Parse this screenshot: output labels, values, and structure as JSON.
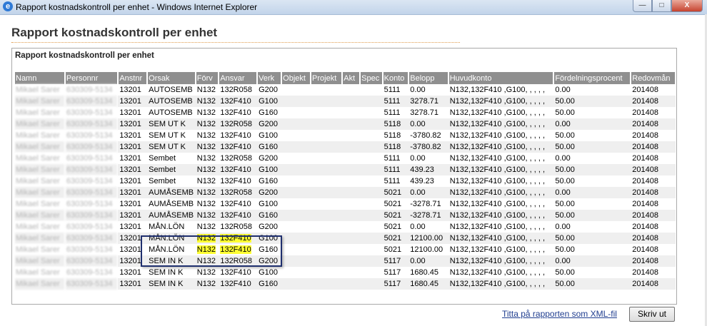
{
  "window": {
    "title": "Rapport kostnadskontroll per enhet - Windows Internet Explorer",
    "icon": "ie-icon",
    "min_label": "—",
    "max_label": "□",
    "close_label": "X"
  },
  "page": {
    "title": "Rapport kostnadskontroll per enhet"
  },
  "report": {
    "heading": "Rapport kostnadskontroll per enhet",
    "columns": [
      "Namn",
      "Personnr",
      "Anstnr",
      "Orsak",
      "Förv",
      "Ansvar",
      "Verk",
      "Objekt",
      "Projekt",
      "Akt",
      "Spec",
      "Konto",
      "Belopp",
      "Huvudkonto",
      "Fördelningsprocent",
      "Redovmån"
    ],
    "rows": [
      [
        "Mikael Sarer",
        "630309-5134",
        "13201",
        "AUTOSEMB",
        "N132",
        "132R058",
        "G200",
        "",
        "",
        "",
        "",
        "5111",
        "0.00",
        "N132,132F410 ,G100, , , , ,",
        "0.00",
        "201408"
      ],
      [
        "Mikael Sarer",
        "630309-5134",
        "13201",
        "AUTOSEMB",
        "N132",
        "132F410",
        "G100",
        "",
        "",
        "",
        "",
        "5111",
        "3278.71",
        "N132,132F410 ,G100, , , , ,",
        "50.00",
        "201408"
      ],
      [
        "Mikael Sarer",
        "630309-5134",
        "13201",
        "AUTOSEMB",
        "N132",
        "132F410",
        "G160",
        "",
        "",
        "",
        "",
        "5111",
        "3278.71",
        "N132,132F410 ,G100, , , , ,",
        "50.00",
        "201408"
      ],
      [
        "Mikael Sarer",
        "630309-5134",
        "13201",
        "SEM UT K",
        "N132",
        "132R058",
        "G200",
        "",
        "",
        "",
        "",
        "5118",
        "0.00",
        "N132,132F410 ,G100, , , , ,",
        "0.00",
        "201408"
      ],
      [
        "Mikael Sarer",
        "630309-5134",
        "13201",
        "SEM UT K",
        "N132",
        "132F410",
        "G100",
        "",
        "",
        "",
        "",
        "5118",
        "-3780.82",
        "N132,132F410 ,G100, , , , ,",
        "50.00",
        "201408"
      ],
      [
        "Mikael Sarer",
        "630309-5134",
        "13201",
        "SEM UT K",
        "N132",
        "132F410",
        "G160",
        "",
        "",
        "",
        "",
        "5118",
        "-3780.82",
        "N132,132F410 ,G100, , , , ,",
        "50.00",
        "201408"
      ],
      [
        "Mikael Sarer",
        "630309-5134",
        "13201",
        "Sembet",
        "N132",
        "132R058",
        "G200",
        "",
        "",
        "",
        "",
        "5111",
        "0.00",
        "N132,132F410 ,G100, , , , ,",
        "0.00",
        "201408"
      ],
      [
        "Mikael Sarer",
        "630309-5134",
        "13201",
        "Sembet",
        "N132",
        "132F410",
        "G100",
        "",
        "",
        "",
        "",
        "5111",
        "439.23",
        "N132,132F410 ,G100, , , , ,",
        "50.00",
        "201408"
      ],
      [
        "Mikael Sarer",
        "630309-5134",
        "13201",
        "Sembet",
        "N132",
        "132F410",
        "G160",
        "",
        "",
        "",
        "",
        "5111",
        "439.23",
        "N132,132F410 ,G100, , , , ,",
        "50.00",
        "201408"
      ],
      [
        "Mikael Sarer",
        "630309-5134",
        "13201",
        "AUMÅSEMB",
        "N132",
        "132R058",
        "G200",
        "",
        "",
        "",
        "",
        "5021",
        "0.00",
        "N132,132F410 ,G100, , , , ,",
        "0.00",
        "201408"
      ],
      [
        "Mikael Sarer",
        "630309-5134",
        "13201",
        "AUMÅSEMB",
        "N132",
        "132F410",
        "G100",
        "",
        "",
        "",
        "",
        "5021",
        "-3278.71",
        "N132,132F410 ,G100, , , , ,",
        "50.00",
        "201408"
      ],
      [
        "Mikael Sarer",
        "630309-5134",
        "13201",
        "AUMÅSEMB",
        "N132",
        "132F410",
        "G160",
        "",
        "",
        "",
        "",
        "5021",
        "-3278.71",
        "N132,132F410 ,G100, , , , ,",
        "50.00",
        "201408"
      ],
      [
        "Mikael Sarer",
        "630309-5134",
        "13201",
        "MÅN.LÖN",
        "N132",
        "132R058",
        "G200",
        "",
        "",
        "",
        "",
        "5021",
        "0.00",
        "N132,132F410 ,G100, , , , ,",
        "0.00",
        "201408"
      ],
      [
        "Mikael Sarer",
        "630309-5134",
        "13201",
        "MÅN.LÖN",
        "N132",
        "132F410",
        "G100",
        "",
        "",
        "",
        "",
        "5021",
        "12100.00",
        "N132,132F410 ,G100, , , , ,",
        "50.00",
        "201408"
      ],
      [
        "Mikael Sarer",
        "630309-5134",
        "13201",
        "MÅN.LÖN",
        "N132",
        "132F410",
        "G160",
        "",
        "",
        "",
        "",
        "5021",
        "12100.00",
        "N132,132F410 ,G100, , , , ,",
        "50.00",
        "201408"
      ],
      [
        "Mikael Sarer",
        "630309-5134",
        "13201",
        "SEM IN K",
        "N132",
        "132R058",
        "G200",
        "",
        "",
        "",
        "",
        "5117",
        "0.00",
        "N132,132F410 ,G100, , , , ,",
        "0.00",
        "201408"
      ],
      [
        "Mikael Sarer",
        "630309-5134",
        "13201",
        "SEM IN K",
        "N132",
        "132F410",
        "G100",
        "",
        "",
        "",
        "",
        "5117",
        "1680.45",
        "N132,132F410 ,G100, , , , ,",
        "50.00",
        "201408"
      ],
      [
        "Mikael Sarer",
        "630309-5134",
        "13201",
        "SEM IN K",
        "N132",
        "132F410",
        "G160",
        "",
        "",
        "",
        "",
        "5117",
        "1680.45",
        "N132,132F410 ,G100, , , , ,",
        "50.00",
        "201408"
      ]
    ],
    "highlighted_rows": [
      13,
      14
    ],
    "highlight_color": "#ffff33",
    "callout_color": "#1f2f6e"
  },
  "footer": {
    "xml_link": "Titta på rapporten som XML-fil",
    "print_button": "Skriv ut"
  }
}
